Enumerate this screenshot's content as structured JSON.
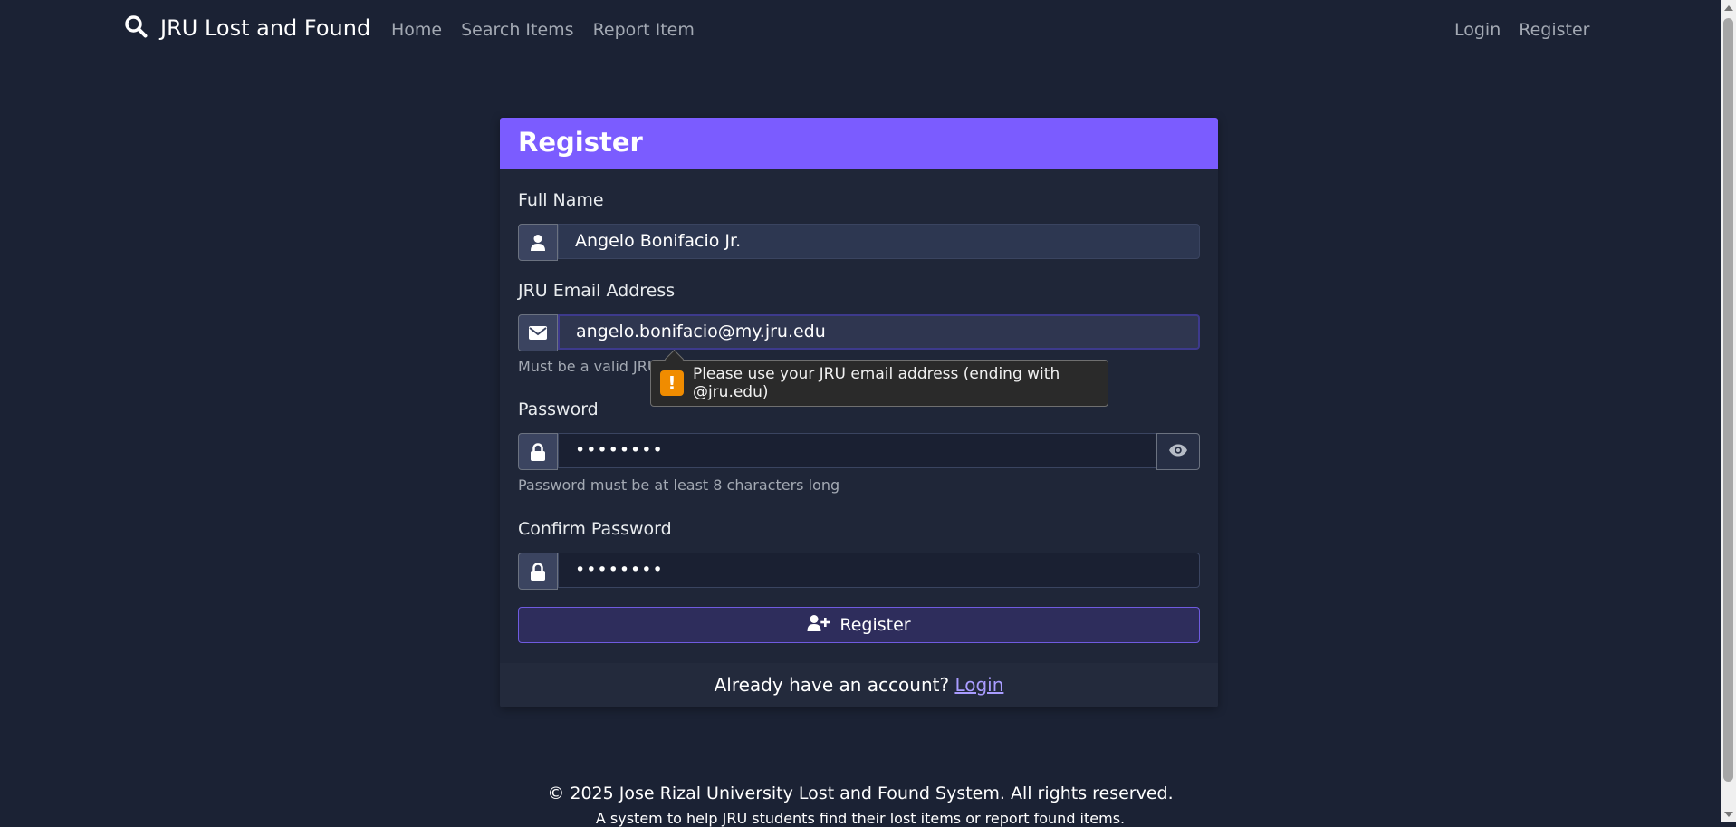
{
  "nav": {
    "brand": "JRU Lost and Found",
    "links": [
      "Home",
      "Search Items",
      "Report Item"
    ],
    "right_links": [
      "Login",
      "Register"
    ]
  },
  "form": {
    "title": "Register",
    "full_name_label": "Full Name",
    "full_name_value": "Angelo Bonifacio Jr.",
    "email_label": "JRU Email Address",
    "email_value": "angelo.bonifacio@my.jru.edu",
    "email_help": "Must be a valid JRU",
    "tooltip": "Please use your JRU email address (ending with @jru.edu)",
    "password_label": "Password",
    "password_value": "••••••••",
    "password_help": "Password must be at least 8 characters long",
    "confirm_label": "Confirm Password",
    "confirm_value": "••••••••",
    "submit_label": "Register",
    "footer_text": "Already have an account?",
    "footer_link": "Login"
  },
  "footer": {
    "copyright": "© 2025 Jose Rizal University Lost and Found System. All rights reserved.",
    "tagline": "A system to help JRU students find their lost items or report found items."
  },
  "icons": [
    "search-icon",
    "user-icon",
    "envelope-icon",
    "lock-icon",
    "eye-icon",
    "user-plus-icon",
    "warning-icon"
  ],
  "colors": {
    "accent": "#7b5cff",
    "background": "#1b2234",
    "card": "#1f2638",
    "warning": "#f08c00"
  }
}
